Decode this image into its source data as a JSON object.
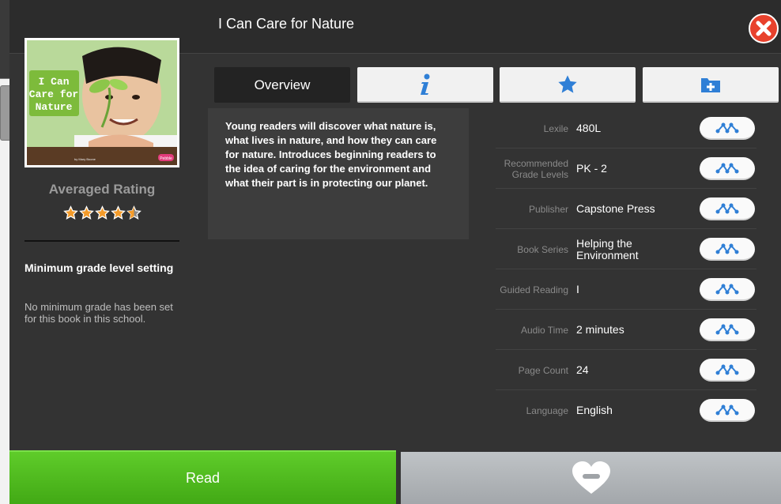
{
  "window": {
    "title": "I Can Care for Nature"
  },
  "cover": {
    "title_line1": "I Can",
    "title_line2": "Care for",
    "title_line3": "Nature",
    "by_line": "by Mary Boone",
    "publisher_mark": "Pebble"
  },
  "rating": {
    "label": "Averaged Rating",
    "value": 4.5,
    "max": 5,
    "star_color": "#f39b2a"
  },
  "min_grade": {
    "title": "Minimum grade level setting",
    "text": "No minimum grade has been set for this book in this school."
  },
  "tabs": [
    {
      "label": "Overview",
      "icon": null
    },
    {
      "label": "",
      "icon": "info-icon"
    },
    {
      "label": "",
      "icon": "star-icon"
    },
    {
      "label": "",
      "icon": "folder-add-icon"
    }
  ],
  "description": "Young readers will discover what nature is, what lives in nature, and how they can care for nature. Introduces beginning readers to the idea of caring for the environment and what their part is in protecting our planet.",
  "details": [
    {
      "label": "Lexile",
      "value": "480L"
    },
    {
      "label": "Recommended Grade Levels",
      "value": "PK - 2"
    },
    {
      "label": "Publisher",
      "value": "Capstone Press"
    },
    {
      "label": "Book Series",
      "value": "Helping the Environment"
    },
    {
      "label": "Guided Reading",
      "value": "I"
    },
    {
      "label": "Audio Time",
      "value": "2 minutes"
    },
    {
      "label": "Page Count",
      "value": "24"
    },
    {
      "label": "Language",
      "value": "English"
    }
  ],
  "actions": {
    "read_label": "Read",
    "favorite_icon": "heart-minus-icon"
  },
  "colors": {
    "accent_blue": "#2f7fd6",
    "read_green": "#4fbb1f",
    "close_red": "#e8412c"
  }
}
